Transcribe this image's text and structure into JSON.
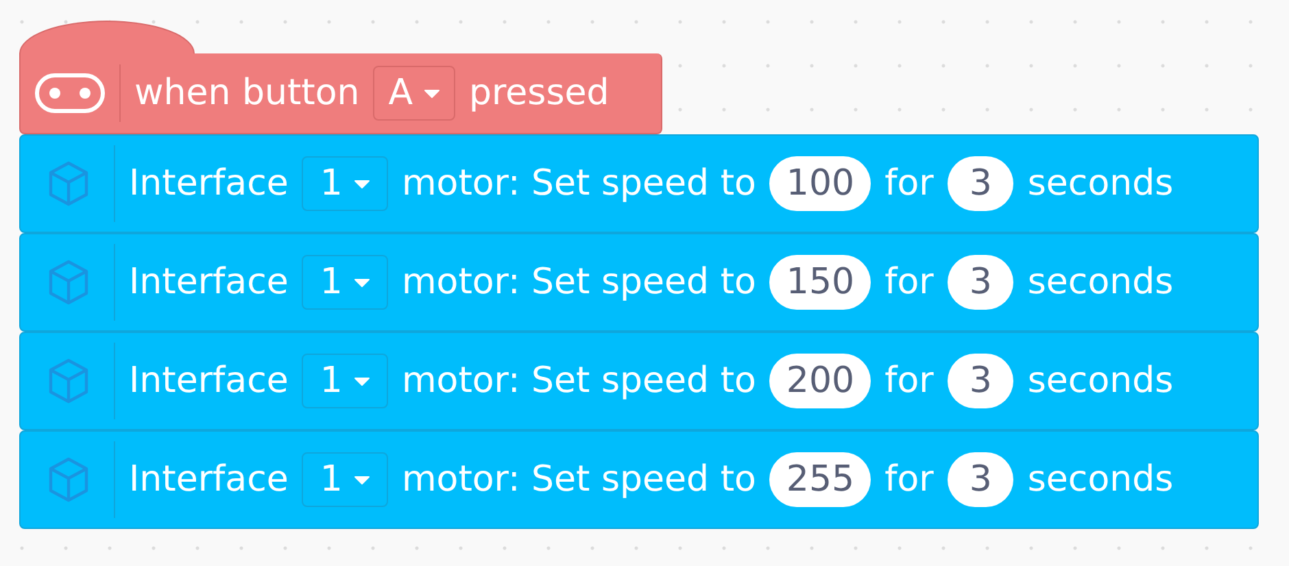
{
  "hat": {
    "label": "when button",
    "button": "A",
    "suffix": "pressed"
  },
  "blocks": [
    {
      "label": "Interface",
      "port": "1",
      "action": "motor: Set speed to",
      "speed": "100",
      "joiner": "for",
      "duration": "3",
      "unit": "seconds"
    },
    {
      "label": "Interface",
      "port": "1",
      "action": "motor: Set speed to",
      "speed": "150",
      "joiner": "for",
      "duration": "3",
      "unit": "seconds"
    },
    {
      "label": "Interface",
      "port": "1",
      "action": "motor: Set speed to",
      "speed": "200",
      "joiner": "for",
      "duration": "3",
      "unit": "seconds"
    },
    {
      "label": "Interface",
      "port": "1",
      "action": "motor: Set speed to",
      "speed": "255",
      "joiner": "for",
      "duration": "3",
      "unit": "seconds"
    }
  ]
}
